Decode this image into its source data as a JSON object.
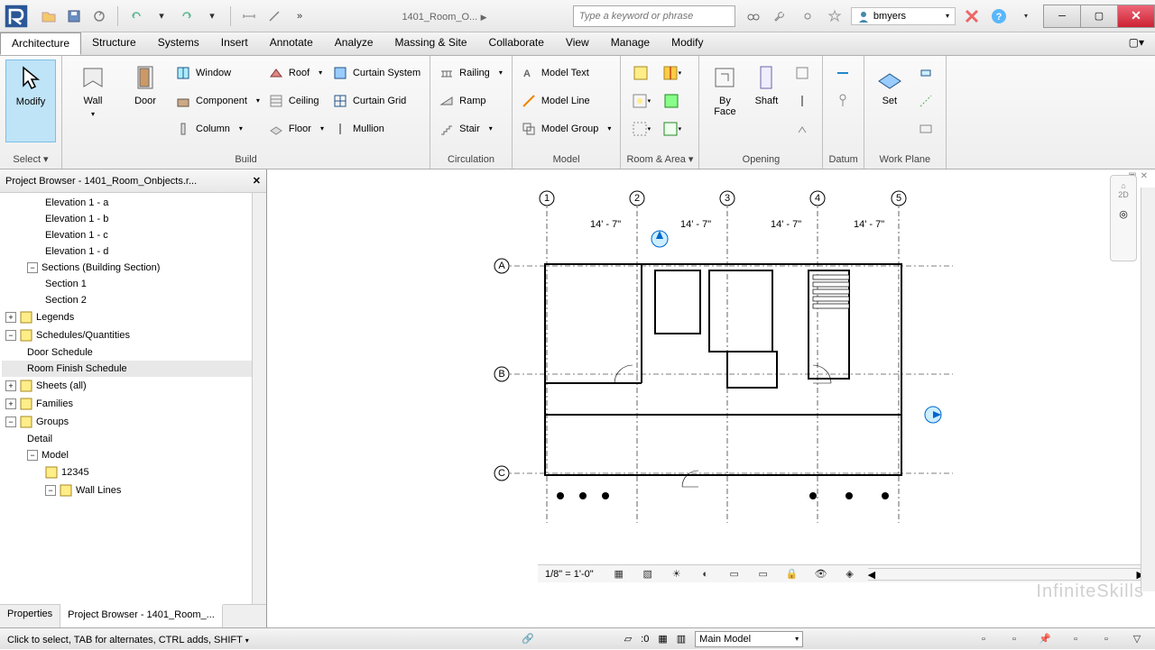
{
  "title": "1401_Room_O...",
  "search_placeholder": "Type a keyword or phrase",
  "user": "bmyers",
  "menu_tabs": [
    "Architecture",
    "Structure",
    "Systems",
    "Insert",
    "Annotate",
    "Analyze",
    "Massing & Site",
    "Collaborate",
    "View",
    "Manage",
    "Modify"
  ],
  "active_tab": "Architecture",
  "ribbon": {
    "select": {
      "label": "Select ▾",
      "modify": "Modify"
    },
    "build": {
      "label": "Build",
      "wall": "Wall",
      "door": "Door",
      "window": "Window",
      "component": "Component",
      "column": "Column",
      "roof": "Roof",
      "ceiling": "Ceiling",
      "floor": "Floor",
      "curtain_system": "Curtain System",
      "curtain_grid": "Curtain Grid",
      "mullion": "Mullion"
    },
    "circulation": {
      "label": "Circulation",
      "railing": "Railing",
      "ramp": "Ramp",
      "stair": "Stair"
    },
    "model": {
      "label": "Model",
      "text": "Model Text",
      "line": "Model Line",
      "group": "Model Group"
    },
    "room_area": {
      "label": "Room & Area ▾"
    },
    "opening": {
      "label": "Opening",
      "by_face": "By\nFace",
      "shaft": "Shaft"
    },
    "datum": {
      "label": "Datum"
    },
    "workplane": {
      "label": "Work Plane",
      "set": "Set"
    }
  },
  "browser": {
    "title": "Project Browser - 1401_Room_Onbjects.r...",
    "items": [
      {
        "label": "Elevation 1 - a",
        "lvl": 2
      },
      {
        "label": "Elevation 1 - b",
        "lvl": 2
      },
      {
        "label": "Elevation 1 - c",
        "lvl": 2
      },
      {
        "label": "Elevation 1 - d",
        "lvl": 2
      },
      {
        "label": "Sections (Building Section)",
        "lvl": 1,
        "exp": "−"
      },
      {
        "label": "Section 1",
        "lvl": 2
      },
      {
        "label": "Section 2",
        "lvl": 2
      },
      {
        "label": "Legends",
        "lvl": 0,
        "exp": "+",
        "ico": "leg"
      },
      {
        "label": "Schedules/Quantities",
        "lvl": 0,
        "exp": "−",
        "ico": "sched"
      },
      {
        "label": "Door Schedule",
        "lvl": 1
      },
      {
        "label": "Room Finish Schedule",
        "lvl": 1,
        "sel": true
      },
      {
        "label": "Sheets (all)",
        "lvl": 0,
        "exp": "+",
        "ico": "sheet"
      },
      {
        "label": "Families",
        "lvl": 0,
        "exp": "+",
        "ico": "fam"
      },
      {
        "label": "Groups",
        "lvl": 0,
        "exp": "−",
        "ico": "grp"
      },
      {
        "label": "Detail",
        "lvl": 1
      },
      {
        "label": "Model",
        "lvl": 1,
        "exp": "−"
      },
      {
        "label": "12345",
        "lvl": 2,
        "ico": "mg"
      },
      {
        "label": "Wall Lines",
        "lvl": 2,
        "exp": "−",
        "ico": "mg"
      }
    ],
    "tabs": {
      "properties": "Properties",
      "browser": "Project Browser - 1401_Room_..."
    }
  },
  "bottombar": {
    "scale": "1/8\" = 1'-0\""
  },
  "status": {
    "text": "Click to select, TAB for alternates, CTRL adds, SHIFT ",
    "zero": ":0",
    "model": "Main Model"
  },
  "watermark": "InfiniteSkills"
}
